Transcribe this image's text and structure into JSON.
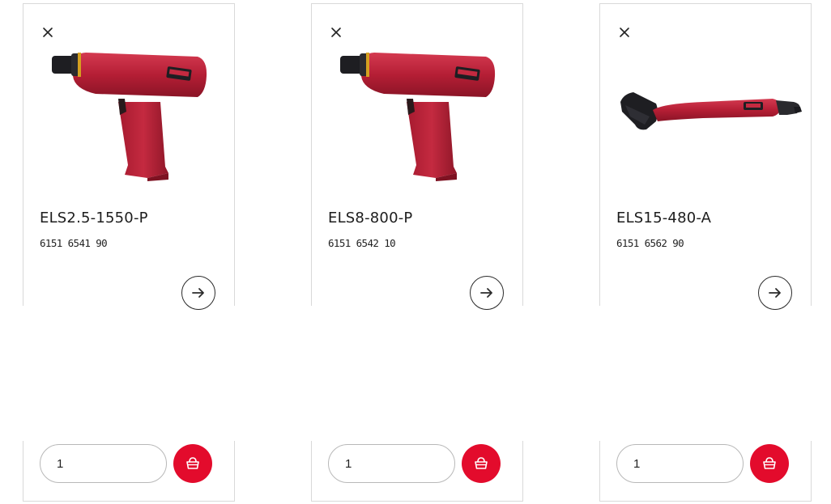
{
  "products": [
    {
      "name": "ELS2.5-1550-P",
      "code": "6151 6541 90",
      "quantity": "1",
      "image": "pistol-grip-screwdriver-image"
    },
    {
      "name": "ELS8-800-P",
      "code": "6151 6542 10",
      "quantity": "1",
      "image": "pistol-grip-screwdriver-image"
    },
    {
      "name": "ELS15-480-A",
      "code": "6151 6562 90",
      "quantity": "1",
      "image": "angle-head-screwdriver-image"
    }
  ],
  "icons": {
    "remove": "close-icon",
    "details": "arrow-right-icon",
    "add_to_cart": "basket-icon"
  },
  "colors": {
    "accent": "#e30b2c",
    "tool_red": "#b51e35",
    "border": "#d9d9d9"
  }
}
